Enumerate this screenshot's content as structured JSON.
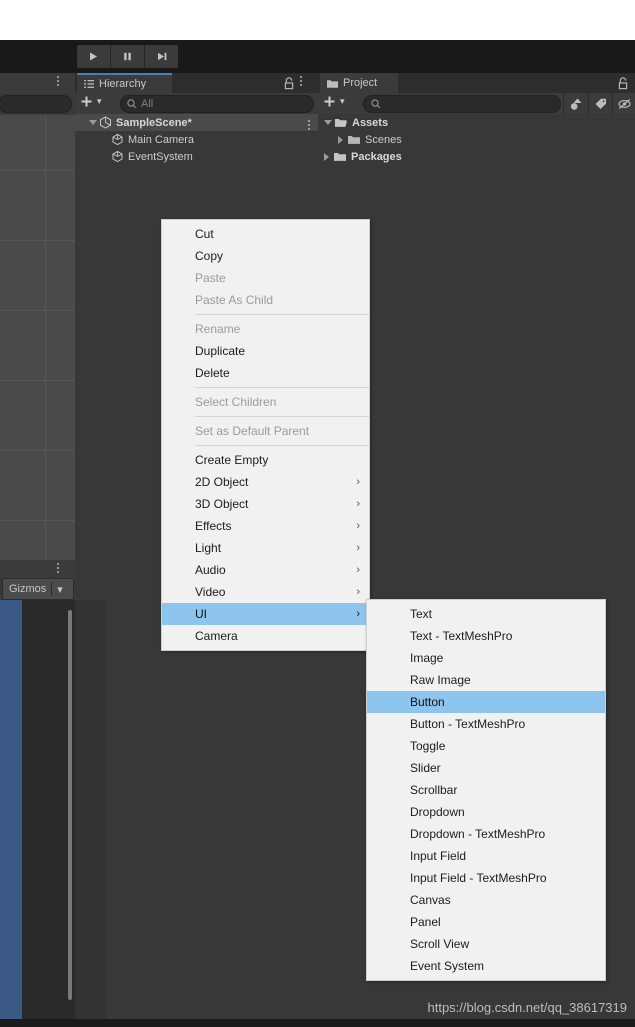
{
  "app": {
    "name": "Unity Editor",
    "accent_blue": "#4a7fb5",
    "menu_highlight": "#8ec5ee",
    "panel_bg": "#383838",
    "menu_bg": "#f1f1f1"
  },
  "toolbar": {
    "play_label": "Play",
    "pause_label": "Pause",
    "step_label": "Step"
  },
  "scene_panel": {
    "gizmos_label": "Gizmos",
    "gizmos_caret": "▾"
  },
  "hierarchy": {
    "tab_label": "Hierarchy",
    "add_caret": "▾",
    "search_value": "",
    "search_placeholder": "All",
    "rows": [
      {
        "label": "SampleScene*",
        "indent": 14,
        "bold": true,
        "selected": true,
        "twisty": "down",
        "icon": "unity-scene-icon",
        "kebab": true
      },
      {
        "label": "Main Camera",
        "indent": 36,
        "bold": false,
        "selected": false,
        "twisty": "none",
        "icon": "gameobject-cube-icon",
        "kebab": false
      },
      {
        "label": "EventSystem",
        "indent": 36,
        "bold": false,
        "selected": false,
        "twisty": "none",
        "icon": "gameobject-cube-icon",
        "kebab": false
      }
    ]
  },
  "project": {
    "tab_label": "Project",
    "add_caret": "▾",
    "search_value": "",
    "search_placeholder": "",
    "rows": [
      {
        "label": "Assets",
        "indent": 8,
        "bold": true,
        "twisty": "down",
        "icon": "folder-open-icon"
      },
      {
        "label": "Scenes",
        "indent": 28,
        "bold": false,
        "twisty": "right",
        "icon": "folder-icon"
      },
      {
        "label": "Packages",
        "indent": 8,
        "bold": true,
        "twisty": "right",
        "icon": "folder-icon"
      }
    ]
  },
  "context_menu": {
    "items": [
      {
        "label": "Cut",
        "enabled": true,
        "submenu": false,
        "highlighted": false
      },
      {
        "label": "Copy",
        "enabled": true,
        "submenu": false,
        "highlighted": false
      },
      {
        "label": "Paste",
        "enabled": false,
        "submenu": false,
        "highlighted": false
      },
      {
        "label": "Paste As Child",
        "enabled": false,
        "submenu": false,
        "highlighted": false
      },
      {
        "separator": true
      },
      {
        "label": "Rename",
        "enabled": false,
        "submenu": false,
        "highlighted": false
      },
      {
        "label": "Duplicate",
        "enabled": true,
        "submenu": false,
        "highlighted": false
      },
      {
        "label": "Delete",
        "enabled": true,
        "submenu": false,
        "highlighted": false
      },
      {
        "separator": true
      },
      {
        "label": "Select Children",
        "enabled": false,
        "submenu": false,
        "highlighted": false
      },
      {
        "separator": true
      },
      {
        "label": "Set as Default Parent",
        "enabled": false,
        "submenu": false,
        "highlighted": false
      },
      {
        "separator": true
      },
      {
        "label": "Create Empty",
        "enabled": true,
        "submenu": false,
        "highlighted": false
      },
      {
        "label": "2D Object",
        "enabled": true,
        "submenu": true,
        "highlighted": false
      },
      {
        "label": "3D Object",
        "enabled": true,
        "submenu": true,
        "highlighted": false
      },
      {
        "label": "Effects",
        "enabled": true,
        "submenu": true,
        "highlighted": false
      },
      {
        "label": "Light",
        "enabled": true,
        "submenu": true,
        "highlighted": false
      },
      {
        "label": "Audio",
        "enabled": true,
        "submenu": true,
        "highlighted": false
      },
      {
        "label": "Video",
        "enabled": true,
        "submenu": true,
        "highlighted": false
      },
      {
        "label": "UI",
        "enabled": true,
        "submenu": true,
        "highlighted": true
      },
      {
        "label": "Camera",
        "enabled": true,
        "submenu": false,
        "highlighted": false
      }
    ],
    "submenu_arrow": "›"
  },
  "ui_submenu": {
    "items": [
      {
        "label": "Text",
        "highlighted": false
      },
      {
        "label": "Text - TextMeshPro",
        "highlighted": false
      },
      {
        "label": "Image",
        "highlighted": false
      },
      {
        "label": "Raw Image",
        "highlighted": false
      },
      {
        "label": "Button",
        "highlighted": true
      },
      {
        "label": "Button - TextMeshPro",
        "highlighted": false
      },
      {
        "label": "Toggle",
        "highlighted": false
      },
      {
        "label": "Slider",
        "highlighted": false
      },
      {
        "label": "Scrollbar",
        "highlighted": false
      },
      {
        "label": "Dropdown",
        "highlighted": false
      },
      {
        "label": "Dropdown - TextMeshPro",
        "highlighted": false
      },
      {
        "label": "Input Field",
        "highlighted": false
      },
      {
        "label": "Input Field - TextMeshPro",
        "highlighted": false
      },
      {
        "label": "Canvas",
        "highlighted": false
      },
      {
        "label": "Panel",
        "highlighted": false
      },
      {
        "label": "Scroll View",
        "highlighted": false
      },
      {
        "label": "Event System",
        "highlighted": false
      }
    ]
  },
  "watermark": {
    "text": "https://blog.csdn.net/qq_38617319"
  }
}
